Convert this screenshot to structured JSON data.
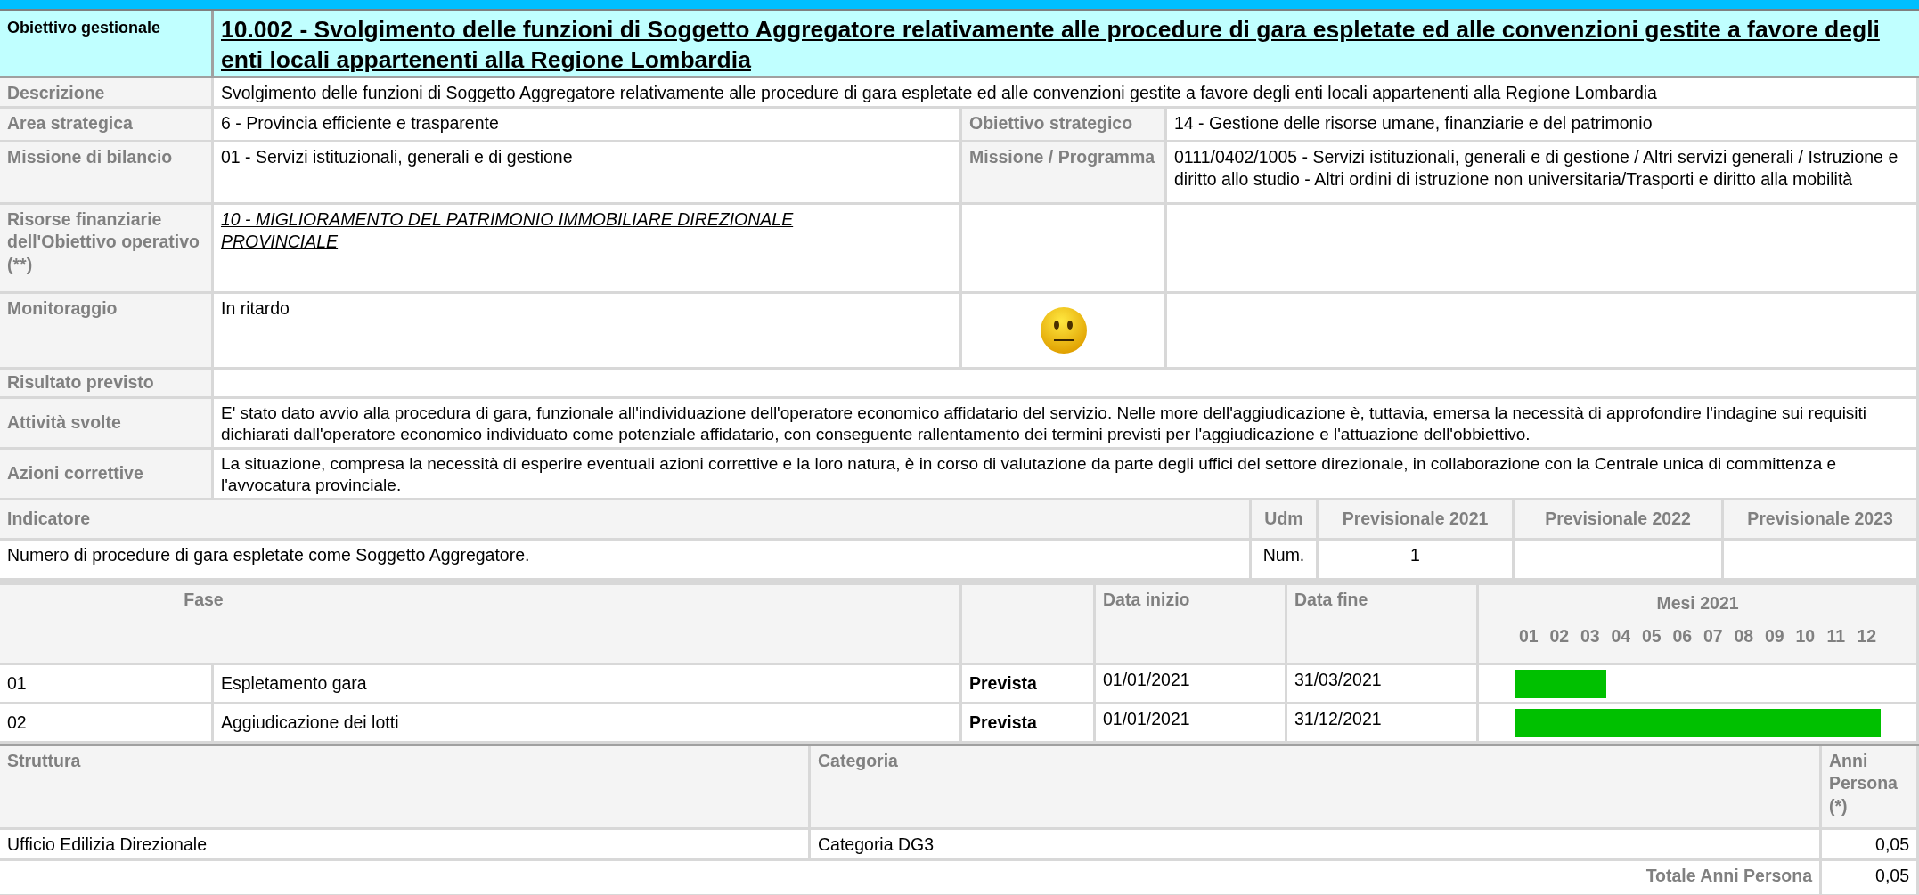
{
  "header": {
    "label": "Obiettivo gestionale",
    "title": "10.002 - Svolgimento delle funzioni di Soggetto Aggregatore relativamente alle procedure di gara espletate ed alle convenzioni gestite a favore degli enti locali appartenenti alla Regione Lombardia"
  },
  "description": {
    "label": "Descrizione",
    "value": "Svolgimento delle funzioni di Soggetto Aggregatore relativamente alle procedure di gara espletate ed alle convenzioni gestite a favore degli enti locali appartenenti alla Regione Lombardia"
  },
  "pairs": [
    {
      "label": "Area strategica",
      "value": "6 - Provincia efficiente e trasparente",
      "label2": "Obiettivo strategico",
      "value2": "14 - Gestione delle risorse umane, finanziarie e del patrimonio"
    },
    {
      "label": "Missione di bilancio",
      "value": "01 - Servizi istituzionali, generali e di gestione",
      "label2": "Missione / Programma",
      "value2": "0111/0402/1005 - Servizi istituzionali, generali e di gestione / Altri servizi generali / Istruzione e diritto allo studio - Altri ordini di istruzione non universitaria/Trasporti e diritto alla mobilità"
    }
  ],
  "resources": {
    "label": "Risorse finanziarie dell'Obiettivo operativo (**)",
    "link": "10 - MIGLIORAMENTO DEL PATRIMONIO IMMOBILIARE DIREZIONALE PROVINCIALE"
  },
  "monitoring": {
    "label": "Monitoraggio",
    "value": "In ritardo"
  },
  "details": [
    {
      "label": "Risultato previsto"
    },
    {
      "label": "Attività svolte",
      "value": "E' stato dato avvio alla procedura di gara, funzionale all'individuazione dell'operatore economico affidatario del servizio. Nelle more dell'aggiudicazione è, tuttavia, emersa la necessità di approfondire l'indagine sui requisiti dichiarati dall'operatore economico individuato come potenziale affidatario, con conseguente rallentamento dei termini previsti per l'aggiudicazione e l'attuazione dell'obbiettivo."
    },
    {
      "label": "Azioni correttive",
      "value": "La situazione, compresa la necessità di esperire eventuali azioni correttive e la loro natura, è in corso di valutazione da parte degli uffici del settore direzionale, in collaborazione con la Centrale unica di committenza e l'avvocatura provinciale."
    }
  ],
  "indicators": {
    "columns": [
      "Indicatore",
      "Udm",
      "Previsionale 2021",
      "Previsionale 2022",
      "Previsionale 2023"
    ],
    "rows": [
      {
        "cells": [
          "Numero di procedure di gara espletate come Soggetto Aggregatore.",
          "Num.",
          "1",
          "",
          ""
        ]
      }
    ]
  },
  "phases": {
    "columns": [
      "Fase",
      "Data inizio",
      "Data fine"
    ],
    "months_title": "Mesi 2021",
    "months": [
      "01",
      "02",
      "03",
      "04",
      "05",
      "06",
      "07",
      "08",
      "09",
      "10",
      "11",
      "12"
    ],
    "rows": [
      {
        "code": "01",
        "name": "Espletamento gara",
        "type": "Prevista",
        "start": "01/01/2021",
        "end": "31/03/2021"
      },
      {
        "code": "02",
        "name": "Aggiudicazione dei lotti",
        "type": "Prevista",
        "start": "01/01/2021",
        "end": "31/12/2021"
      }
    ]
  },
  "staff": {
    "columns": [
      "Struttura",
      "Categoria",
      "Anni Persona (*)"
    ],
    "rows": [
      {
        "structure": "Ufficio Edilizia Direzionale",
        "category": "Categoria DG3",
        "years": "0,05"
      }
    ],
    "total_label": "Totale Anni Persona",
    "total": "0,05"
  }
}
